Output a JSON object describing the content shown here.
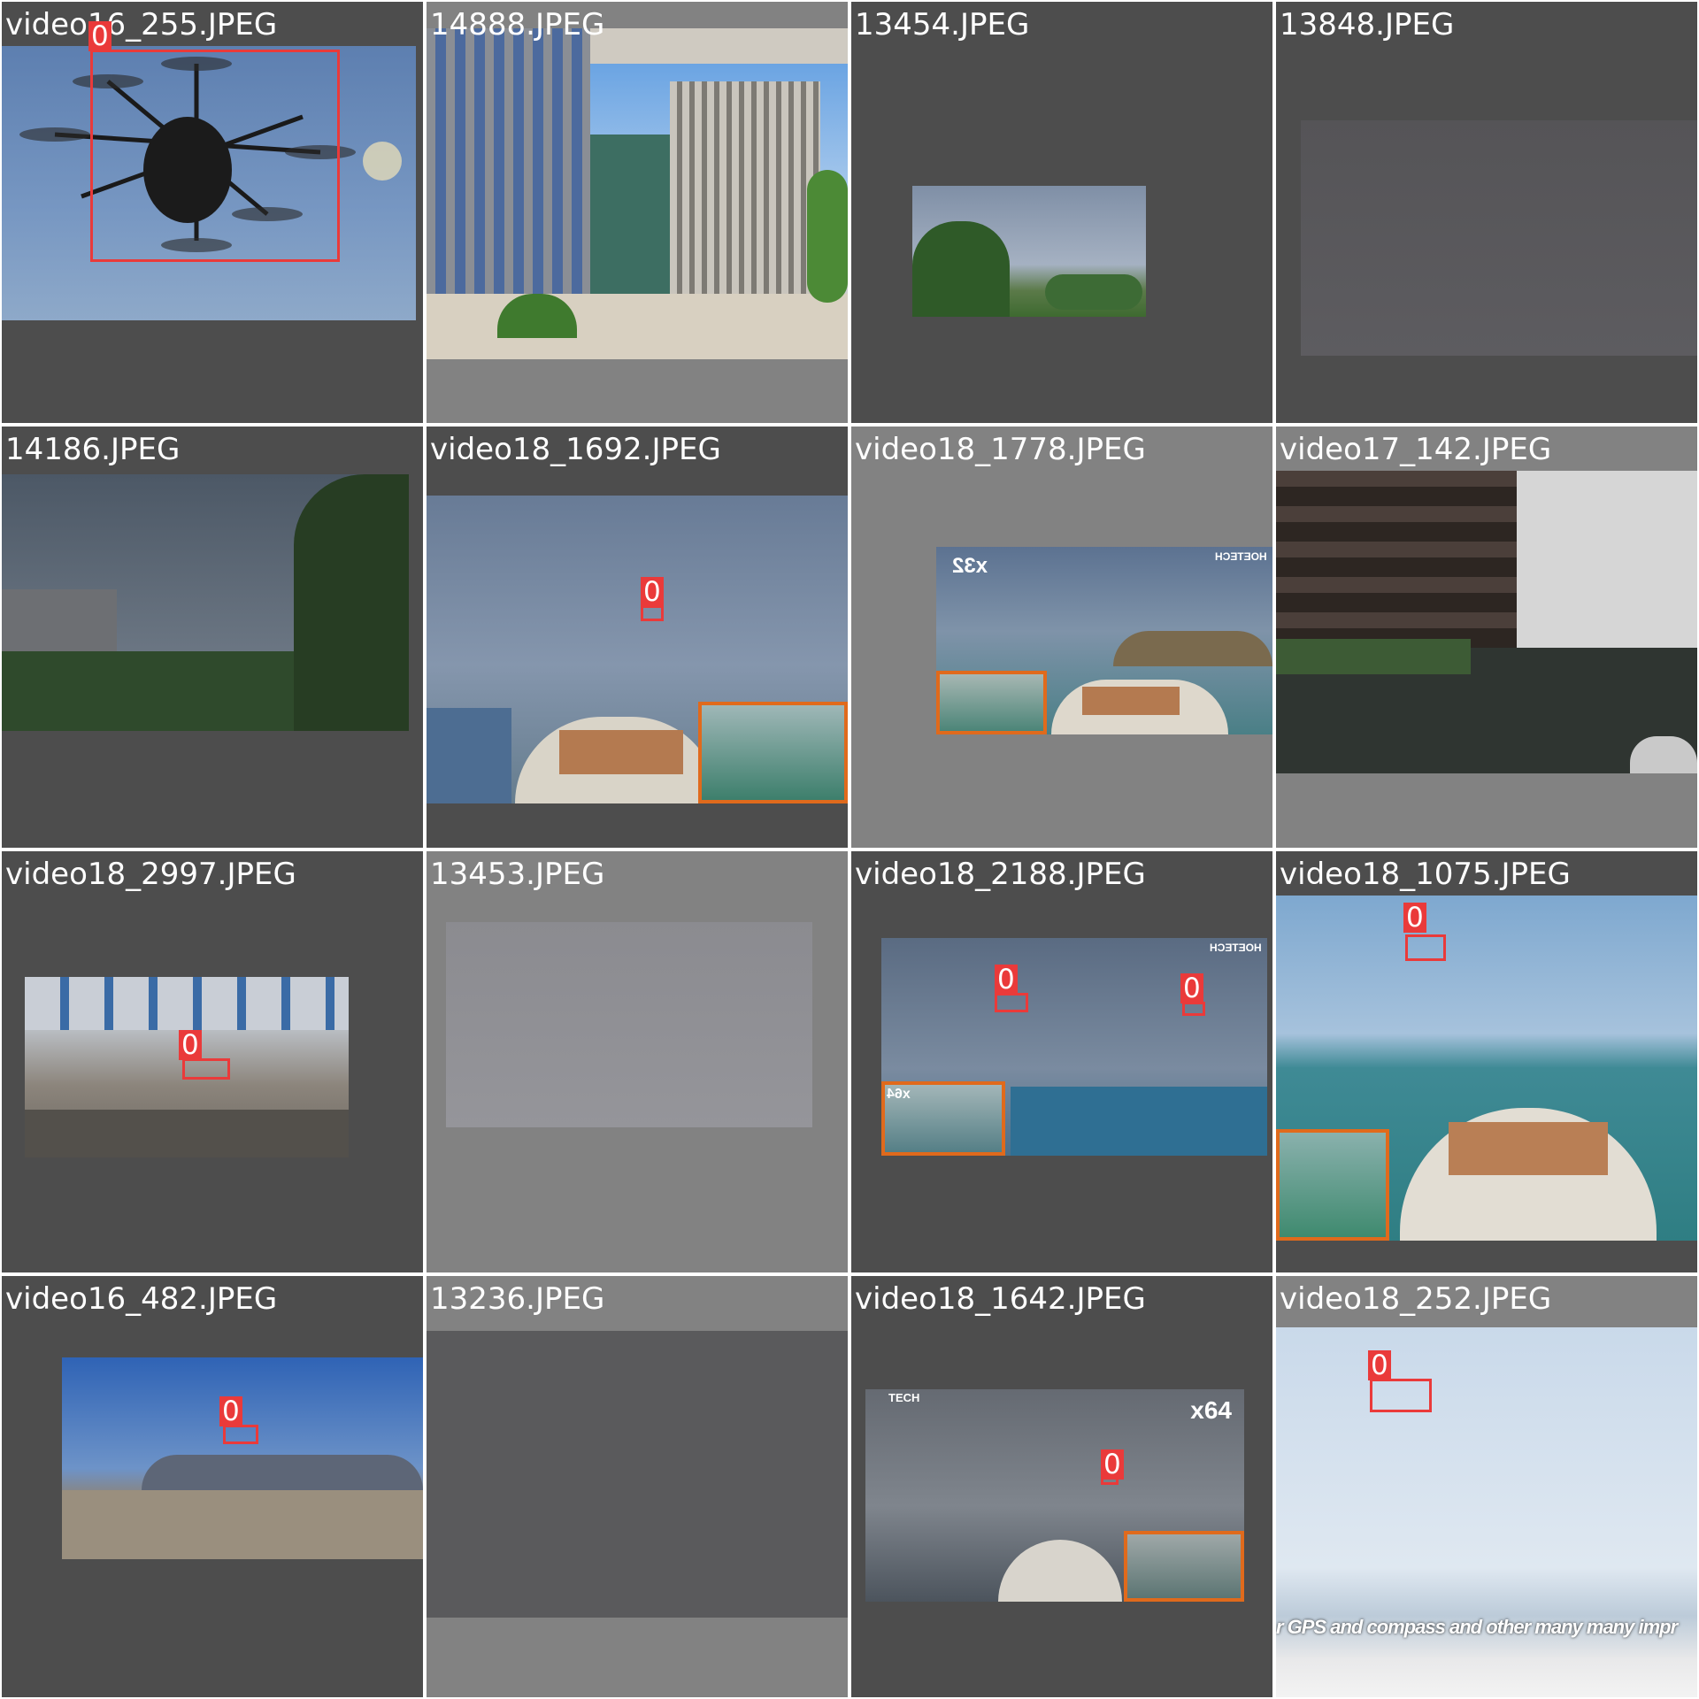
{
  "grid": {
    "tiles": [
      {
        "title": "video16_255.JPEG",
        "labels": [
          "0"
        ]
      },
      {
        "title": "14888.JPEG",
        "labels": []
      },
      {
        "title": "13454.JPEG",
        "labels": []
      },
      {
        "title": "13848.JPEG",
        "labels": []
      },
      {
        "title": "14186.JPEG",
        "labels": []
      },
      {
        "title": "video18_1692.JPEG",
        "labels": [
          "0"
        ]
      },
      {
        "title": "video18_1778.JPEG",
        "labels": []
      },
      {
        "title": "video17_142.JPEG",
        "labels": []
      },
      {
        "title": "video18_2997.JPEG",
        "labels": [
          "0"
        ]
      },
      {
        "title": "13453.JPEG",
        "labels": []
      },
      {
        "title": "video18_2188.JPEG",
        "labels": [
          "0",
          "0"
        ]
      },
      {
        "title": "video18_1075.JPEG",
        "labels": [
          "0"
        ]
      },
      {
        "title": "video16_482.JPEG",
        "labels": [
          "0"
        ]
      },
      {
        "title": "13236.JPEG",
        "labels": []
      },
      {
        "title": "video18_1642.JPEG",
        "labels": [
          "0"
        ]
      },
      {
        "title": "video18_252.JPEG",
        "labels": [
          "0"
        ]
      }
    ]
  },
  "overlays": {
    "t6_zoom": "x32",
    "t6_brand": "HOETECH",
    "t10_zoom": "x64",
    "t10_brand": "HOETECH",
    "t14_zoom": "x64",
    "t14_brand": "TECH",
    "t15_caption": "r GPS and compass and other many many impr"
  },
  "colors": {
    "box": "#ea3a3a",
    "tile_dark": "#4d4d4d",
    "tile_light": "#828282"
  }
}
